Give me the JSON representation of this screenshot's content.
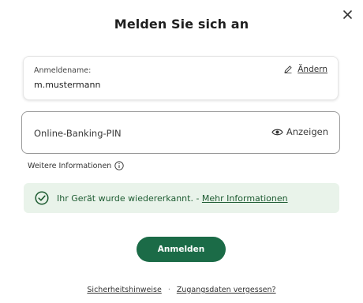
{
  "dialog": {
    "title": "Melden Sie sich an",
    "close_icon": "close-icon"
  },
  "username": {
    "label": "Anmeldename:",
    "value": "m.mustermann",
    "change_label": "Ändern",
    "change_icon": "pencil-icon"
  },
  "pin": {
    "placeholder": "Online-Banking-PIN",
    "show_label": "Anzeigen",
    "show_icon": "eye-icon"
  },
  "more_info": {
    "label": "Weitere Informationen",
    "icon": "info-icon"
  },
  "device_notice": {
    "text": "Ihr Gerät wurde wiedererkannt. -",
    "link": "Mehr Informationen",
    "icon": "check-circle-icon"
  },
  "login_button": {
    "label": "Anmelden"
  },
  "footer": {
    "security_link": "Sicherheitshinweise",
    "separator": "·",
    "forgot_link": "Zugangsdaten vergessen?"
  },
  "colors": {
    "primary": "#1b6b47",
    "notice_bg": "#e9f3ea",
    "notice_text": "#1d5b31"
  }
}
